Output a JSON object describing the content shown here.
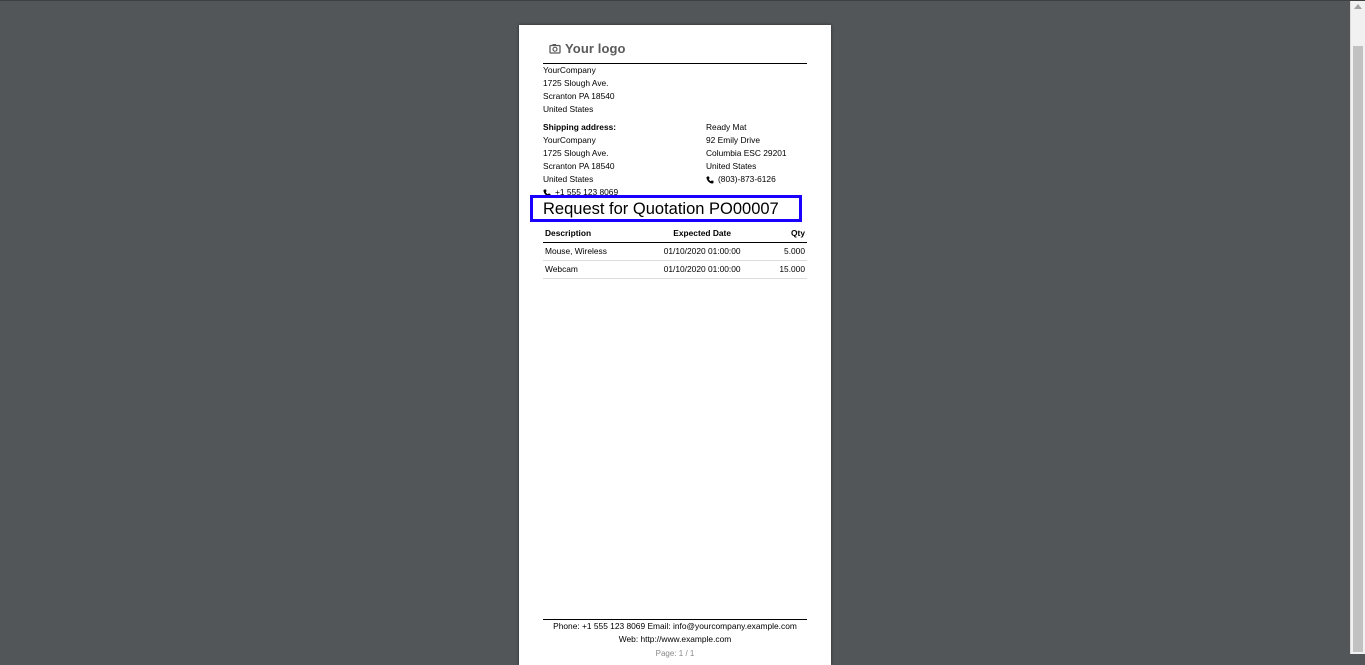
{
  "document": {
    "logo_text": "Your logo",
    "company": {
      "name": "YourCompany",
      "street": "1725 Slough Ave.",
      "city": "Scranton PA 18540",
      "country": "United States"
    },
    "shipping": {
      "label": "Shipping address:",
      "name": "YourCompany",
      "street": "1725 Slough Ave.",
      "city": "Scranton PA 18540",
      "country": "United States",
      "phone": "+1 555 123 8069"
    },
    "vendor": {
      "name": "Ready Mat",
      "street": "92 Emily Drive",
      "city": "Columbia ESC 29201",
      "country": "United States",
      "phone": "(803)-873-6126"
    },
    "title": "Request for Quotation PO00007",
    "table": {
      "headers": [
        "Description",
        "Expected Date",
        "Qty"
      ],
      "rows": [
        [
          "Mouse, Wireless",
          "01/10/2020 01:00:00",
          "5.000"
        ],
        [
          "Webcam",
          "01/10/2020 01:00:00",
          "15.000"
        ]
      ]
    },
    "footer": {
      "line1": "Phone: +1 555 123 8069   Email: info@yourcompany.example.com",
      "line2": "Web: http://www.example.com",
      "pager": "Page: 1 / 1"
    }
  },
  "icons": {
    "logo": "camera-icon",
    "phone": "phone-icon"
  },
  "colors": {
    "viewer_background": "#525659",
    "highlight_box": "#1a00ff"
  }
}
